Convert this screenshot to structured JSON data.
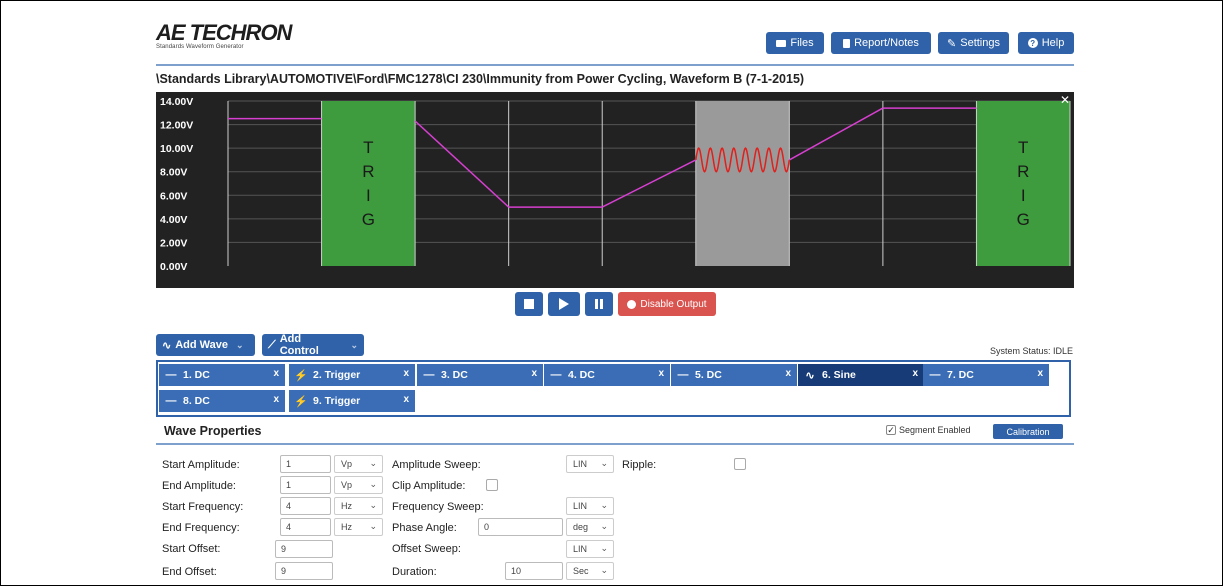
{
  "header": {
    "logo_main": "AE TECHRON",
    "logo_sub": "Standards Waveform Generator",
    "buttons": {
      "files": "Files",
      "report": "Report/Notes",
      "settings": "Settings",
      "help": "Help"
    },
    "path": "\\Standards Library\\AUTOMOTIVE\\Ford\\FMC1278\\CI 230\\Immunity from Power Cycling, Waveform B (7-1-2015)"
  },
  "chart_data": {
    "type": "line",
    "y_tick_labels": [
      "14.00V",
      "12.00V",
      "10.00V",
      "8.00V",
      "6.00V",
      "4.00V",
      "2.00V",
      "0.00V"
    ],
    "ylim": [
      0,
      14
    ],
    "segments": [
      {
        "segment": 1,
        "kind": "DC",
        "start": 12.5,
        "end": 12.5
      },
      {
        "segment": 2,
        "kind": "Trigger",
        "label": [
          "T",
          "R",
          "I",
          "G"
        ]
      },
      {
        "segment": 3,
        "kind": "DC",
        "start": 12.3,
        "end": 5.0
      },
      {
        "segment": 4,
        "kind": "DC",
        "start": 5.0,
        "end": 5.0
      },
      {
        "segment": 5,
        "kind": "DC",
        "start": 5.0,
        "end": 9.0
      },
      {
        "segment": 6,
        "kind": "Sine",
        "offset": 9.0,
        "amplitude": 1.0,
        "cycles": 8
      },
      {
        "segment": 7,
        "kind": "DC",
        "start": 9.0,
        "end": 13.4
      },
      {
        "segment": 8,
        "kind": "DC",
        "start": 13.4,
        "end": 13.4
      },
      {
        "segment": 9,
        "kind": "Trigger",
        "label": [
          "T",
          "R",
          "I",
          "G"
        ]
      }
    ],
    "colors": {
      "trace": "#d63fd0",
      "sine": "#e0201c",
      "trigger": "#3e9c3e",
      "selected": "#9a9a9a",
      "background": "#222222"
    },
    "grid": true
  },
  "controls": {
    "disable_output": "Disable Output"
  },
  "add": {
    "wave": "Add Wave",
    "control": "Add Control"
  },
  "status": "System Status: IDLE",
  "segments": [
    {
      "label": "1. DC",
      "icon": "dc-line-icon"
    },
    {
      "label": "2. Trigger",
      "icon": "trigger-bolt-icon"
    },
    {
      "label": "3. DC",
      "icon": "dc-line-icon"
    },
    {
      "label": "4. DC",
      "icon": "dc-line-icon"
    },
    {
      "label": "5. DC",
      "icon": "dc-line-icon"
    },
    {
      "label": "6. Sine",
      "icon": "sine-wave-icon"
    },
    {
      "label": "7. DC",
      "icon": "dc-line-icon"
    },
    {
      "label": "8. DC",
      "icon": "dc-line-icon"
    },
    {
      "label": "9. Trigger",
      "icon": "trigger-bolt-icon"
    }
  ],
  "segment_close": "x",
  "wave_props": {
    "title": "Wave Properties",
    "segment_enabled": "Segment Enabled",
    "calibration": "Calibration",
    "start_amplitude": {
      "label": "Start Amplitude:",
      "value": "1",
      "unit": "Vp"
    },
    "end_amplitude": {
      "label": "End Amplitude:",
      "value": "1",
      "unit": "Vp"
    },
    "start_frequency": {
      "label": "Start Frequency:",
      "value": "4",
      "unit": "Hz"
    },
    "end_frequency": {
      "label": "End Frequency:",
      "value": "4",
      "unit": "Hz"
    },
    "start_offset": {
      "label": "Start Offset:",
      "value": "9"
    },
    "end_offset": {
      "label": "End Offset:",
      "value": "9"
    },
    "amplitude_sweep": {
      "label": "Amplitude Sweep:",
      "value": "LIN"
    },
    "clip_amplitude": {
      "label": "Clip Amplitude:"
    },
    "frequency_sweep": {
      "label": "Frequency Sweep:",
      "value": "LIN"
    },
    "phase_angle": {
      "label": "Phase Angle:",
      "value": "0",
      "unit": "deg"
    },
    "offset_sweep": {
      "label": "Offset Sweep:",
      "value": "LIN"
    },
    "duration": {
      "label": "Duration:",
      "value": "10",
      "unit": "Sec"
    },
    "ripple": {
      "label": "Ripple:"
    }
  }
}
